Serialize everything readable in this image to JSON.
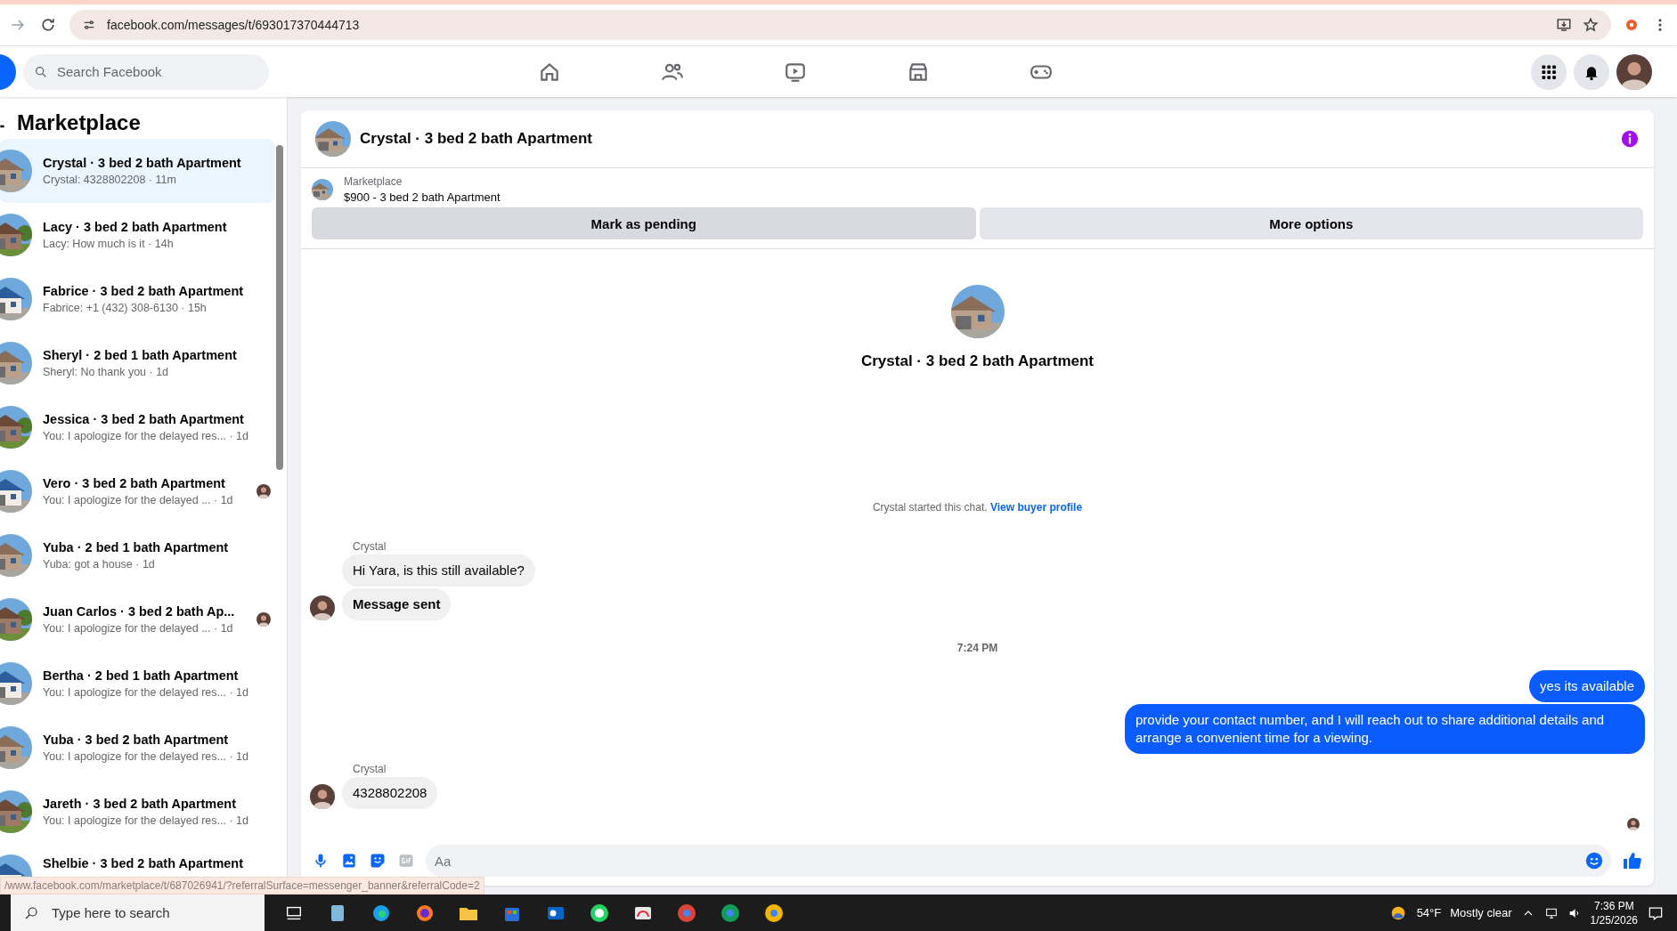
{
  "browser": {
    "url": "facebook.com/messages/t/693017370444713"
  },
  "nav": {
    "search_placeholder": "Search Facebook"
  },
  "sidebar": {
    "title": "Marketplace",
    "conversations": [
      {
        "title": "Crystal · 3 bed 2 bath Apartment",
        "snippet": "Crystal: 4328802208 · 11m",
        "selected": true,
        "seen": false
      },
      {
        "title": "Lacy · 3 bed 2 bath Apartment",
        "snippet": "Lacy: How much is it · 14h",
        "selected": false,
        "seen": false
      },
      {
        "title": "Fabrice · 3 bed 2 bath Apartment",
        "snippet": "Fabrice: +1 (432) 308-6130 · 15h",
        "selected": false,
        "seen": false
      },
      {
        "title": "Sheryl · 2 bed 1 bath Apartment",
        "snippet": "Sheryl: No thank you · 1d",
        "selected": false,
        "seen": false
      },
      {
        "title": "Jessica · 3 bed 2 bath Apartment",
        "snippet": "You: I apologize for the delayed res... · 1d",
        "selected": false,
        "seen": false
      },
      {
        "title": "Vero · 3 bed 2 bath Apartment",
        "snippet": "You: I apologize for the delayed ... · 1d",
        "selected": false,
        "seen": true
      },
      {
        "title": "Yuba · 2 bed 1 bath Apartment",
        "snippet": "Yuba: got a house · 1d",
        "selected": false,
        "seen": false
      },
      {
        "title": "Juan Carlos · 3 bed 2 bath Ap...",
        "snippet": "You: I apologize for the delayed ... · 1d",
        "selected": false,
        "seen": true
      },
      {
        "title": "Bertha · 2 bed 1 bath Apartment",
        "snippet": "You: I apologize for the delayed res... · 1d",
        "selected": false,
        "seen": false
      },
      {
        "title": "Yuba · 3 bed 2 bath Apartment",
        "snippet": "You: I apologize for the delayed res... · 1d",
        "selected": false,
        "seen": false
      },
      {
        "title": "Jareth · 3 bed 2 bath Apartment",
        "snippet": "You: I apologize for the delayed res... · 1d",
        "selected": false,
        "seen": false
      },
      {
        "title": "Shelbie · 3 bed 2 bath Apartment",
        "selected": false,
        "seen": false
      }
    ]
  },
  "chat": {
    "title": "Crystal · 3 bed 2 bath Apartment",
    "listing": {
      "label": "Marketplace",
      "text": "$900 - 3 bed 2 bath Apartment"
    },
    "actions": [
      "Mark as pending",
      "More options"
    ],
    "intro": {
      "title": "Crystal · 3 bed 2 bath Apartment",
      "note": "Crystal started this chat.",
      "link": "View buyer profile"
    },
    "messages": [
      {
        "kind": "sender",
        "text": "Crystal"
      },
      {
        "kind": "incoming",
        "text": "Hi Yara, is this still available?",
        "avatar": false,
        "bold": false
      },
      {
        "kind": "incoming",
        "text": "Message sent",
        "avatar": true,
        "bold": true
      },
      {
        "kind": "time",
        "text": "7:24 PM"
      },
      {
        "kind": "outgoing",
        "text": "yes its available"
      },
      {
        "kind": "outgoing",
        "text": "provide your contact number, and I will reach out to share additional details and arrange a convenient time for a viewing."
      },
      {
        "kind": "sender",
        "text": "Crystal"
      },
      {
        "kind": "incoming",
        "text": "4328802208",
        "avatar": true,
        "bold": false
      },
      {
        "kind": "seen"
      }
    ],
    "composer": {
      "placeholder": "Aa"
    }
  },
  "status_url": "/www.facebook.com/marketplace/t/687026941/?referralSurface=messenger_banner&referralCode=2",
  "taskbar": {
    "search_placeholder": "Type here to search",
    "temperature": "54°F",
    "weather": "Mostly clear",
    "time": "7:36 PM",
    "date": "1/25/2026"
  }
}
